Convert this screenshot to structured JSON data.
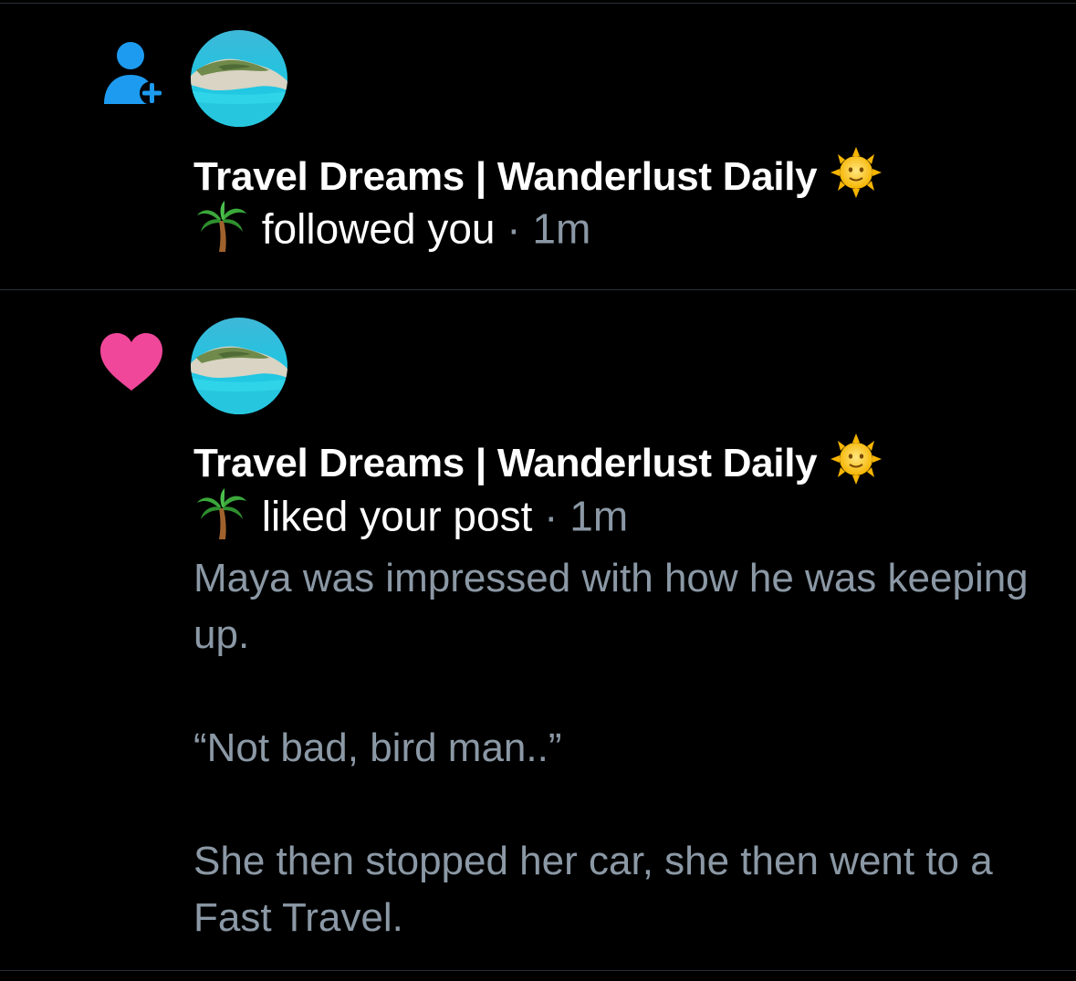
{
  "colors": {
    "background": "#000000",
    "follow_icon": "#1d9bf0",
    "like_icon": "#f0479a",
    "secondary_text": "#8b98a5",
    "divider": "#2a2f36"
  },
  "notifications": [
    {
      "type_icon": "person-add-icon",
      "avatar": "beach-cliff-avatar",
      "account_name": "Travel Dreams | Wanderlust Daily",
      "name_emoji": "sun-with-face-emoji",
      "action_emoji": "palm-tree-emoji",
      "action": "followed you",
      "separator": "·",
      "time": "1m"
    },
    {
      "type_icon": "heart-icon",
      "avatar": "beach-cliff-avatar",
      "account_name": "Travel Dreams | Wanderlust Daily",
      "name_emoji": "sun-with-face-emoji",
      "action_emoji": "palm-tree-emoji",
      "action": "liked your post",
      "separator": "·",
      "time": "1m",
      "post_text": "Maya was impressed with how he was keeping up.\n\n“Not bad, bird man..”\n\nShe then stopped her car, she then went to a Fast Travel."
    }
  ]
}
